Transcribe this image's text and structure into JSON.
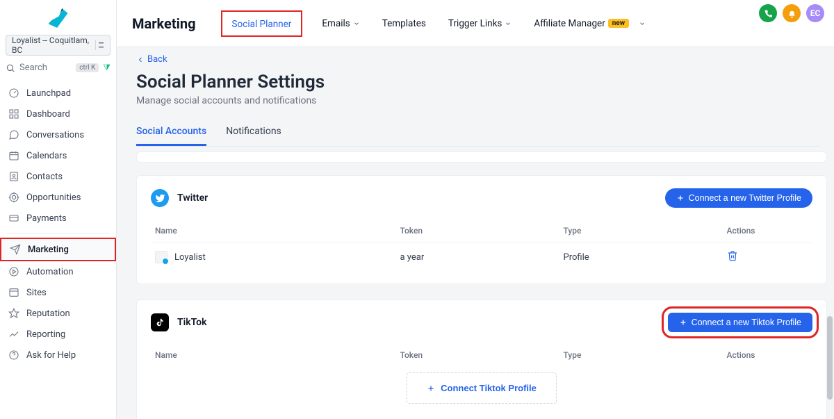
{
  "account_selector": "Loyalist -- Coquitlam, BC",
  "search": {
    "placeholder": "Search",
    "kbd": "ctrl K"
  },
  "sidebar": {
    "items": [
      {
        "label": "Launchpad"
      },
      {
        "label": "Dashboard"
      },
      {
        "label": "Conversations"
      },
      {
        "label": "Calendars"
      },
      {
        "label": "Contacts"
      },
      {
        "label": "Opportunities"
      },
      {
        "label": "Payments"
      },
      {
        "label": "Marketing"
      },
      {
        "label": "Automation"
      },
      {
        "label": "Sites"
      },
      {
        "label": "Reputation"
      },
      {
        "label": "Reporting"
      },
      {
        "label": "Ask for Help"
      }
    ]
  },
  "topnav": {
    "brand": "Marketing",
    "items": [
      {
        "label": "Social Planner"
      },
      {
        "label": "Emails"
      },
      {
        "label": "Templates"
      },
      {
        "label": "Trigger Links"
      },
      {
        "label": "Affiliate Manager"
      }
    ],
    "new_badge": "new"
  },
  "avatar_initials": "EC",
  "back_label": "Back",
  "page_title": "Social Planner Settings",
  "page_subtitle": "Manage social accounts and notifications",
  "subtabs": [
    {
      "label": "Social Accounts"
    },
    {
      "label": "Notifications"
    }
  ],
  "columns": {
    "name": "Name",
    "token": "Token",
    "type": "Type",
    "actions": "Actions"
  },
  "twitter": {
    "title": "Twitter",
    "connect_btn": "Connect a new Twitter Profile",
    "rows": [
      {
        "name": "Loyalist",
        "token": "a year",
        "type": "Profile"
      }
    ]
  },
  "tiktok": {
    "title": "TikTok",
    "connect_btn": "Connect a new Tiktok Profile",
    "empty_btn": "Connect Tiktok Profile"
  }
}
